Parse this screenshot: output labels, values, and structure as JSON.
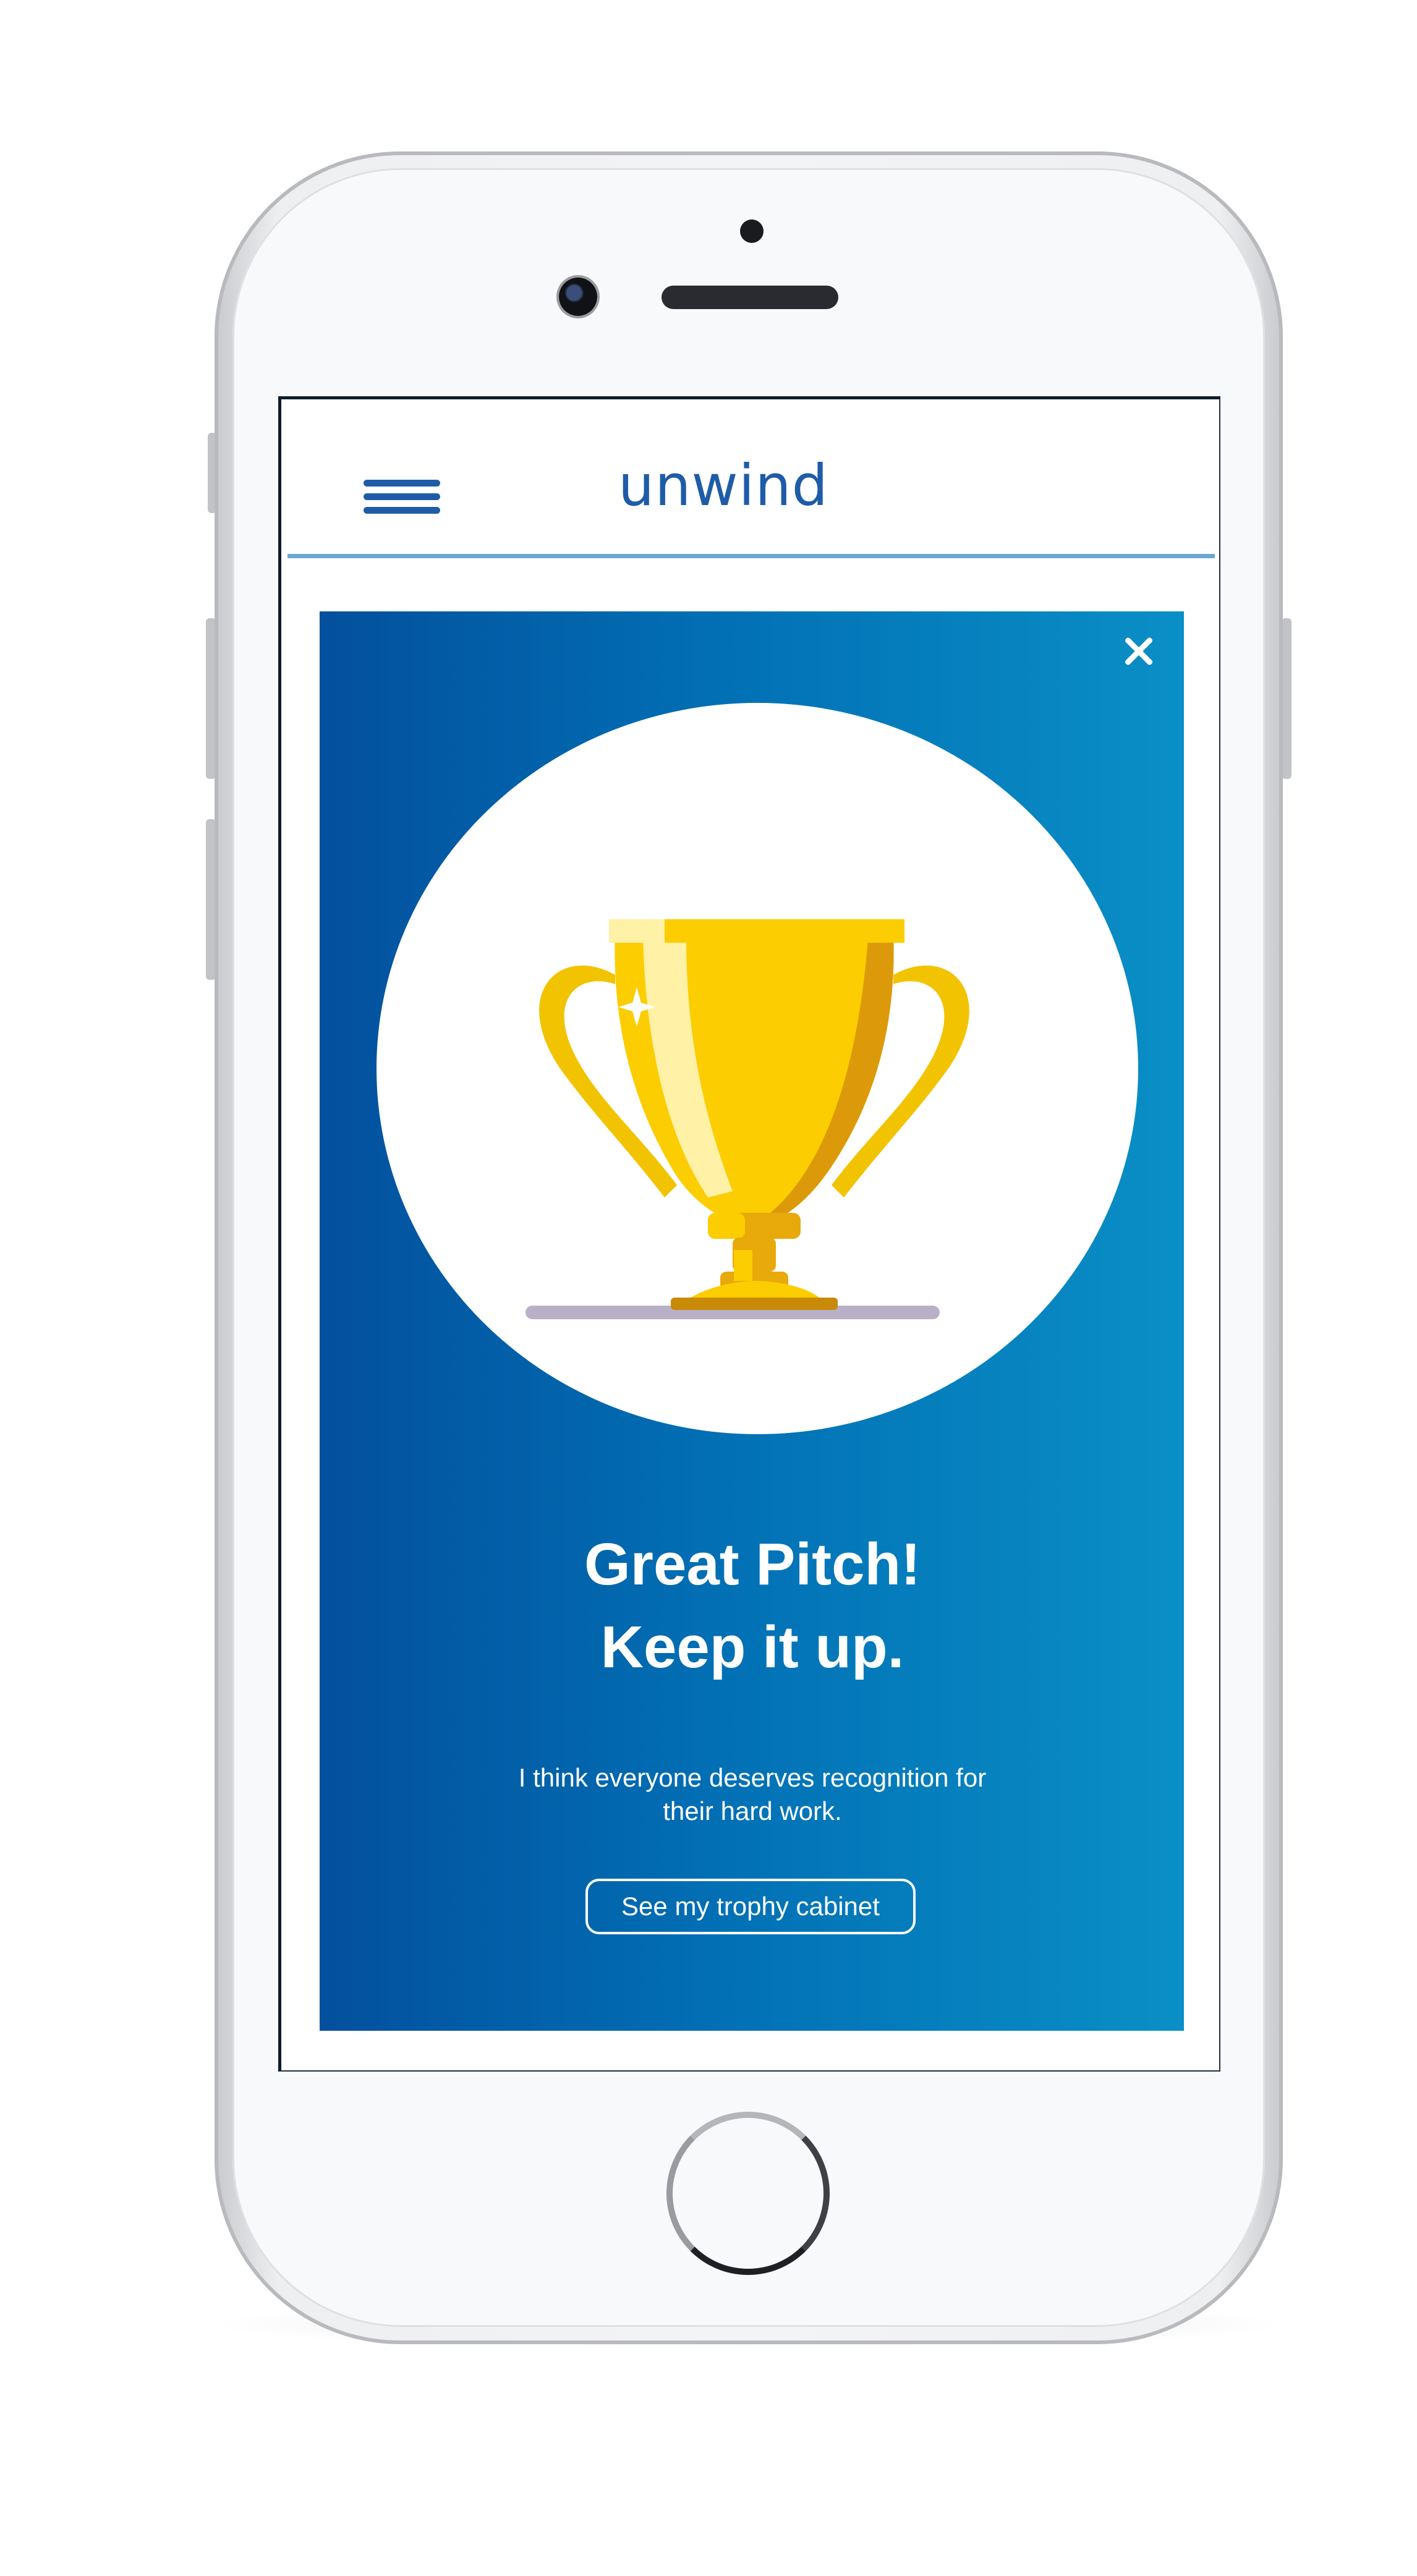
{
  "app": {
    "title": "unwind"
  },
  "header": {
    "menu_icon": "hamburger-menu-icon"
  },
  "modal": {
    "close_icon": "close-icon",
    "illustration": "trophy-icon",
    "headline_line1": "Great Pitch!",
    "headline_line2": "Keep it up.",
    "body_line1": "I think everyone deserves recognition for",
    "body_line2": "their hard work.",
    "cta_label": "See my trophy cabinet"
  },
  "colors": {
    "brand_blue": "#1e5ca8",
    "card_gradient_start": "#03509d",
    "card_gradient_end": "#0a8fc6",
    "trophy_gold": "#fccd00",
    "header_rule": "#6aa8d4"
  }
}
